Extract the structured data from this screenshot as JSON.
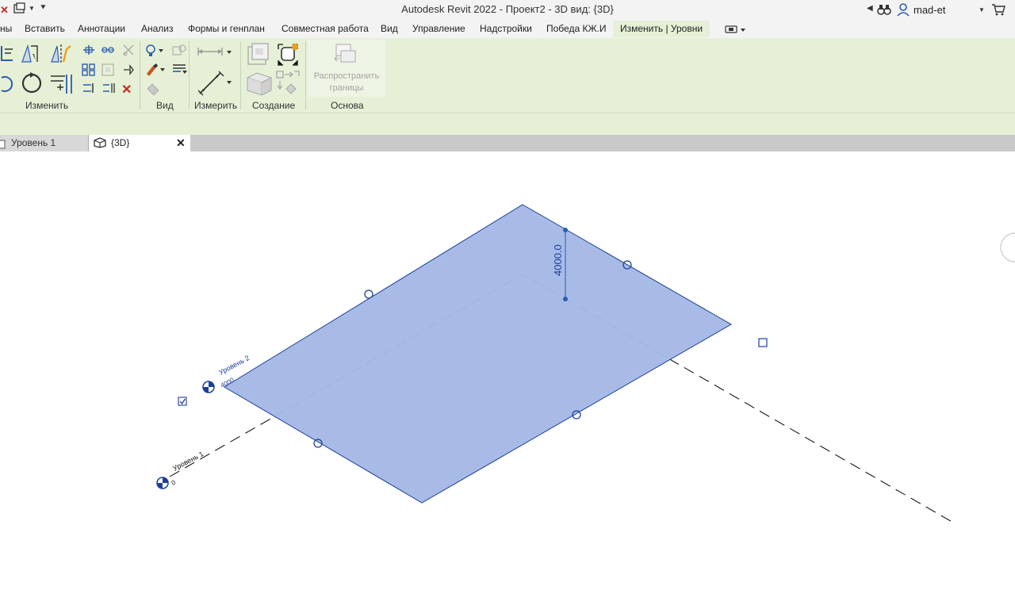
{
  "app": {
    "window_title": "Autodesk Revit 2022 - Проект2 - 3D вид: {3D}",
    "user": "mad-et"
  },
  "ribbon_tabs": [
    {
      "label": "ны"
    },
    {
      "label": "Вставить"
    },
    {
      "label": "Аннотации"
    },
    {
      "label": "Анализ"
    },
    {
      "label": "Формы и генплан"
    },
    {
      "label": "Совместная работа"
    },
    {
      "label": "Вид"
    },
    {
      "label": "Управление"
    },
    {
      "label": "Надстройки"
    },
    {
      "label": "Победа КЖ.И"
    },
    {
      "label": "Изменить | Уровни"
    }
  ],
  "panels": {
    "modify": "Изменить",
    "view": "Вид",
    "measure": "Измерить",
    "create": "Создание",
    "base": "Основа",
    "propagate_line1": "Распространить",
    "propagate_line2": "границы"
  },
  "view_tabs": [
    {
      "label": "Уровень 1"
    },
    {
      "label": "{3D}"
    }
  ],
  "viewport": {
    "dimension": "4000.0",
    "level2_name": "Уровень 2",
    "level2_elev": "4000",
    "level1_name": "Уровень 1",
    "level1_elev": "0"
  },
  "colors": {
    "level_plane": "#a4b8e6",
    "level_edge": "#1c3f9c",
    "ribbon_bg": "#e6f0d6"
  }
}
